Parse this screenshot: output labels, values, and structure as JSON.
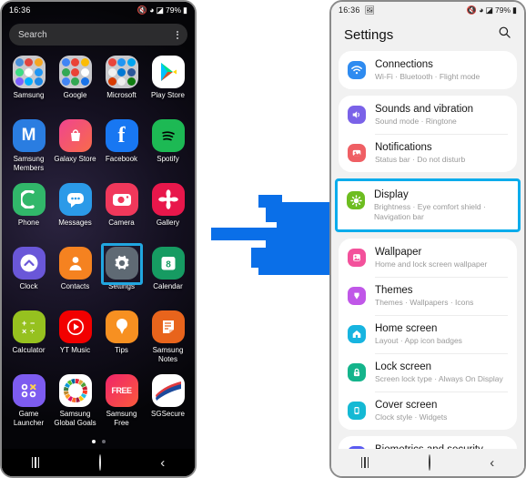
{
  "left_phone": {
    "status": {
      "time": "16:36",
      "icons": [
        "mute-icon",
        "wifi-icon",
        "signal-icon"
      ],
      "battery": "79%"
    },
    "search": {
      "placeholder": "Search",
      "menu_icon": "kebab-menu-icon"
    },
    "apps": [
      {
        "label": "Samsung",
        "type": "folder",
        "colors": [
          "#4a90d9",
          "#e0453e",
          "#f5a623",
          "#3ddc84",
          "#ffffff",
          "#2196f3",
          "#7b61ff",
          "#00b0ff",
          "#1e88e5"
        ]
      },
      {
        "label": "Google",
        "type": "folder",
        "colors": [
          "#4285f4",
          "#ea4335",
          "#fbbc05",
          "#34a853",
          "#ea4335",
          "#ffffff",
          "#4285f4",
          "#34a853",
          "#1a73e8"
        ]
      },
      {
        "label": "Microsoft",
        "type": "folder",
        "colors": [
          "#e8453c",
          "#2196f3",
          "#00a4ef",
          "#f1f1f1",
          "#0078d4",
          "#2b579a",
          "#d83b01",
          "#eeeeee",
          "#107c10"
        ]
      },
      {
        "label": "Play Store",
        "type": "play",
        "color": "#ffffff"
      },
      {
        "label": "Samsung Members",
        "type": "glyph",
        "color": "#2a7de1",
        "glyph": "M"
      },
      {
        "label": "Galaxy Store",
        "type": "glyph",
        "color": "#e8368f",
        "glyph": "■"
      },
      {
        "label": "Facebook",
        "type": "glyph",
        "color": "#1877f2",
        "glyph": "f"
      },
      {
        "label": "Spotify",
        "type": "glyph",
        "color": "#1db954",
        "glyph": "♫"
      },
      {
        "label": "Phone",
        "type": "glyph",
        "color": "#31b76a",
        "glyph": "✆"
      },
      {
        "label": "Messages",
        "type": "glyph",
        "color": "#2b9ae8",
        "glyph": "●"
      },
      {
        "label": "Camera",
        "type": "glyph",
        "color": "#f0385b",
        "glyph": "◉"
      },
      {
        "label": "Gallery",
        "type": "glyph",
        "color": "#e8174b",
        "glyph": "✽"
      },
      {
        "label": "Clock",
        "type": "glyph",
        "color": "#6a57d8",
        "glyph": "▲"
      },
      {
        "label": "Contacts",
        "type": "glyph",
        "color": "#f58220",
        "glyph": "☺"
      },
      {
        "label": "Settings",
        "type": "glyph",
        "color": "#5b6670",
        "glyph": "⚙",
        "selected": true
      },
      {
        "label": "Calendar",
        "type": "glyph",
        "color": "#169b62",
        "glyph": "8"
      },
      {
        "label": "Calculator",
        "type": "glyph",
        "color": "#96c11f",
        "glyph": "÷"
      },
      {
        "label": "YT Music",
        "type": "glyph",
        "color": "#f20000",
        "glyph": "▶"
      },
      {
        "label": "Tips",
        "type": "glyph",
        "color": "#f79021",
        "glyph": "●"
      },
      {
        "label": "Samsung Notes",
        "type": "glyph",
        "color": "#e8641c",
        "glyph": "▤"
      },
      {
        "label": "Game Launcher",
        "type": "glyph",
        "color": "#7d5cf0",
        "glyph": "⬚"
      },
      {
        "label": "Samsung Global Goals",
        "type": "goals",
        "color": "#ffffff"
      },
      {
        "label": "Samsung Free",
        "type": "glyph",
        "color": "#f0246a",
        "glyph": "FREE"
      },
      {
        "label": "SGSecure",
        "type": "glyph",
        "color": "#ffffff",
        "glyph": "✒"
      }
    ],
    "page_dots": {
      "count": 2,
      "active": 0
    },
    "navbar": [
      "recents-icon",
      "home-icon",
      "back-icon"
    ]
  },
  "right_phone": {
    "status": {
      "time": "16:36",
      "icons": [
        "screenshot-icon",
        "mute-icon",
        "wifi-icon",
        "signal-icon"
      ],
      "battery": "79%"
    },
    "header": {
      "title": "Settings",
      "search_icon": "search-icon"
    },
    "groups": [
      {
        "highlight": false,
        "rows": [
          {
            "title": "Connections",
            "subtitle": "Wi-Fi  ·  Bluetooth  ·  Flight mode",
            "icon": "wifi-icon",
            "color": "#2e8bf0"
          }
        ]
      },
      {
        "highlight": false,
        "rows": [
          {
            "title": "Sounds and vibration",
            "subtitle": "Sound mode  ·  Ringtone",
            "icon": "volume-icon",
            "color": "#7a62e8"
          },
          {
            "title": "Notifications",
            "subtitle": "Status bar  ·  Do not disturb",
            "icon": "notification-icon",
            "color": "#ef5f64"
          }
        ]
      },
      {
        "highlight": true,
        "rows": [
          {
            "title": "Display",
            "subtitle": "Brightness  ·  Eye comfort shield  ·  Navigation bar",
            "icon": "brightness-icon",
            "color": "#6dbd20"
          }
        ]
      },
      {
        "highlight": false,
        "rows": [
          {
            "title": "Wallpaper",
            "subtitle": "Home and lock screen wallpaper",
            "icon": "wallpaper-icon",
            "color": "#f3519b"
          },
          {
            "title": "Themes",
            "subtitle": "Themes  ·  Wallpapers  ·  Icons",
            "icon": "themes-icon",
            "color": "#c057e8"
          },
          {
            "title": "Home screen",
            "subtitle": "Layout  ·  App icon badges",
            "icon": "home-icon",
            "color": "#17b4e0"
          },
          {
            "title": "Lock screen",
            "subtitle": "Screen lock type  ·  Always On Display",
            "icon": "lock-icon",
            "color": "#14b48b"
          },
          {
            "title": "Cover screen",
            "subtitle": "Clock style  ·  Widgets",
            "icon": "cover-screen-icon",
            "color": "#14b9d4"
          }
        ]
      },
      {
        "highlight": false,
        "clipped": true,
        "rows": [
          {
            "title": "Biometrics and security",
            "subtitle": "",
            "icon": "fingerprint-icon",
            "color": "#5b5bf0"
          }
        ]
      }
    ],
    "navbar": [
      "recents-icon",
      "home-icon",
      "back-icon"
    ]
  },
  "annotation": {
    "arrow": {
      "name": "pixelated-right-arrow",
      "color": "#0a6fe8",
      "direction": "right"
    },
    "highlight_color": "#0aaceb"
  }
}
